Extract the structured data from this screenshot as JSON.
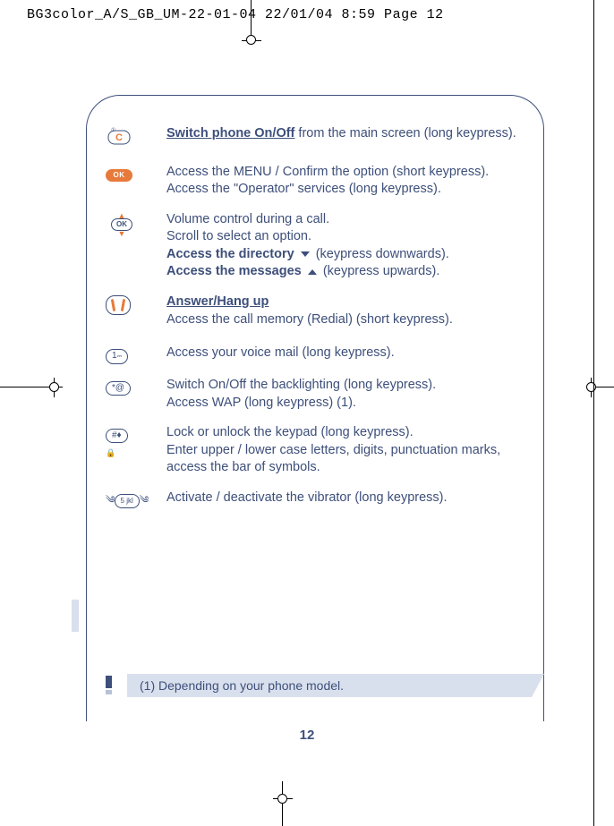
{
  "header": {
    "line": "BG3color_A/S_GB_UM-22-01-04  22/01/04  8:59  Page 12"
  },
  "rows": [
    {
      "icon": "c-key-icon",
      "parts": [
        "Switch phone On/Off",
        " from the main screen (long keypress)."
      ]
    },
    {
      "icon": "ok-filled-icon",
      "ok_label": "OK",
      "lines": [
        "Access the MENU / Confirm the option (short keypress).",
        "Access the \"Operator\" services (long keypress)."
      ]
    },
    {
      "icon": "ok-scroll-icon",
      "ok_label": "OK",
      "line1": "Volume control during a call.",
      "line2": "Scroll to select an option.",
      "dir_label": "Access the directory",
      "dir_tail": "(keypress downwards).",
      "msg_label": "Access the messages",
      "msg_tail": "(keypress upwards)."
    },
    {
      "icon": "answer-icon",
      "heading": "Answer/Hang up",
      "line2": "Access the call memory (Redial) (short keypress)."
    },
    {
      "icon": "key-1-icon",
      "key_label": "1",
      "text": "Access your voice mail (long keypress)."
    },
    {
      "icon": "key-star-icon",
      "key_label": "*@",
      "line1": "Switch On/Off the backlighting (long keypress).",
      "line2": "Access WAP (long keypress) (1)."
    },
    {
      "icon": "key-hash-icon",
      "key_label": "#♦",
      "line1": "Lock or unlock the keypad (long keypress).",
      "line2": "Enter upper / lower case letters, digits, punctuation marks, access the bar of symbols."
    },
    {
      "icon": "key-5-vib-icon",
      "key_label": "5 jkl",
      "text": "Activate / deactivate the vibrator (long keypress)."
    }
  ],
  "footnote": "(1)  Depending on your phone model.",
  "page_number": "12"
}
